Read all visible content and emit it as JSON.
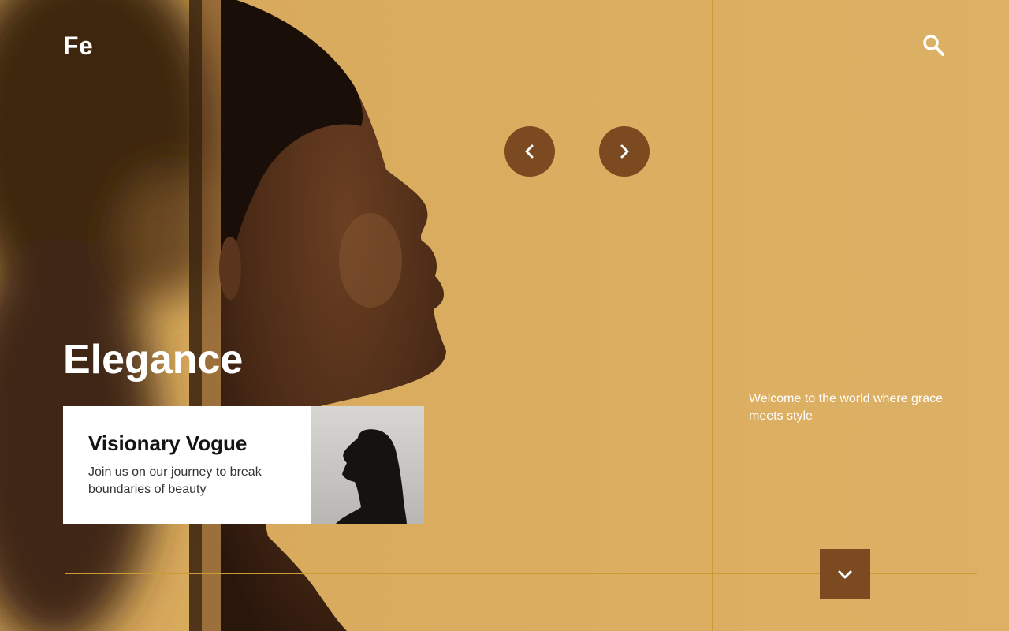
{
  "brand": {
    "logo_text": "Fe"
  },
  "hero": {
    "headline": "Elegance",
    "welcome_text": "Welcome to the world where grace meets style"
  },
  "feature_card": {
    "title": "Visionary Vogue",
    "description": "Join us on our journey to break boundaries of beauty"
  },
  "icons": {
    "search": "search-icon",
    "prev": "chevron-left-icon",
    "next": "chevron-right-icon",
    "scroll": "chevron-down-icon"
  },
  "colors": {
    "background": "#dcaf63",
    "accent_brown": "#7b4a20",
    "gridline": "#c99a35",
    "text_light": "#ffffff",
    "card_bg": "#ffffff"
  }
}
